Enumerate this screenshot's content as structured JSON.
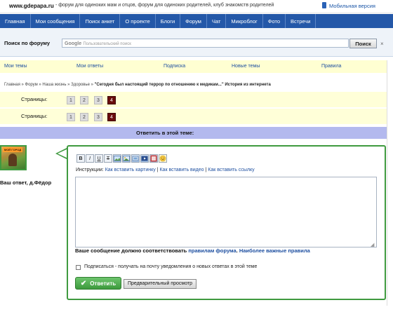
{
  "header": {
    "site": "www.gdepapa.ru",
    "tagline": " - форум для одиноких мам и отцов, форум для одиноких родителей, клуб знакомств родителей",
    "mobile_label": "Мобильная версия"
  },
  "nav": [
    "Главная",
    "Мои сообщения",
    "Поиск анкет",
    "О проекте",
    "Блоги",
    "Форум",
    "Чат",
    "Микроблог",
    "Фото",
    "Встречи"
  ],
  "search": {
    "label": "Поиск по форуму",
    "placeholder": "Пользовательский поиск",
    "google": "Google",
    "button": "Поиск",
    "close": "×"
  },
  "tabs": [
    "Мои темы",
    "Мои ответы",
    "Подписка",
    "Новые темы",
    "Правила"
  ],
  "breadcrumb": {
    "path": "Главная » Форум » Наша жизнь » Здоровье » ",
    "topic": "\"Сегодня был настоящий террор по отношению к медикам...\" История из интернета"
  },
  "pagination": {
    "label": "Страницы:",
    "pages": [
      "1",
      "2",
      "3",
      "4"
    ],
    "active": "4"
  },
  "reply": {
    "title": "Ответить в этой теме:",
    "name_label": "Ваш ответ, д.Фёдор",
    "avatar_sign": "МОЙ ГОРОД"
  },
  "toolbar": [
    "B",
    "I",
    "U",
    "T"
  ],
  "instructions": {
    "prefix": "Инструкции: ",
    "img_link": "Как вставить картинку",
    "sep": " | ",
    "video_link": "Как вставить видео",
    "link_link": "Как вставить ссылку"
  },
  "rules": {
    "prefix": "Ваше сообщение должно соответствовать ",
    "link1": "правилам форума",
    "mid": ". ",
    "link2": "Наиболее важные правила"
  },
  "subscribe": "Подписаться - получать на почту уведомления о новых ответах в этой теме",
  "buttons": {
    "submit": "Ответить",
    "preview": "Предварительный просмотр"
  },
  "colors": {
    "nav": "#2458a8",
    "tabs_bg": "#ffffd2",
    "reply_header": "#b3b9ee",
    "form_border": "#3f9a3f",
    "active_page": "#6a0d0d"
  }
}
